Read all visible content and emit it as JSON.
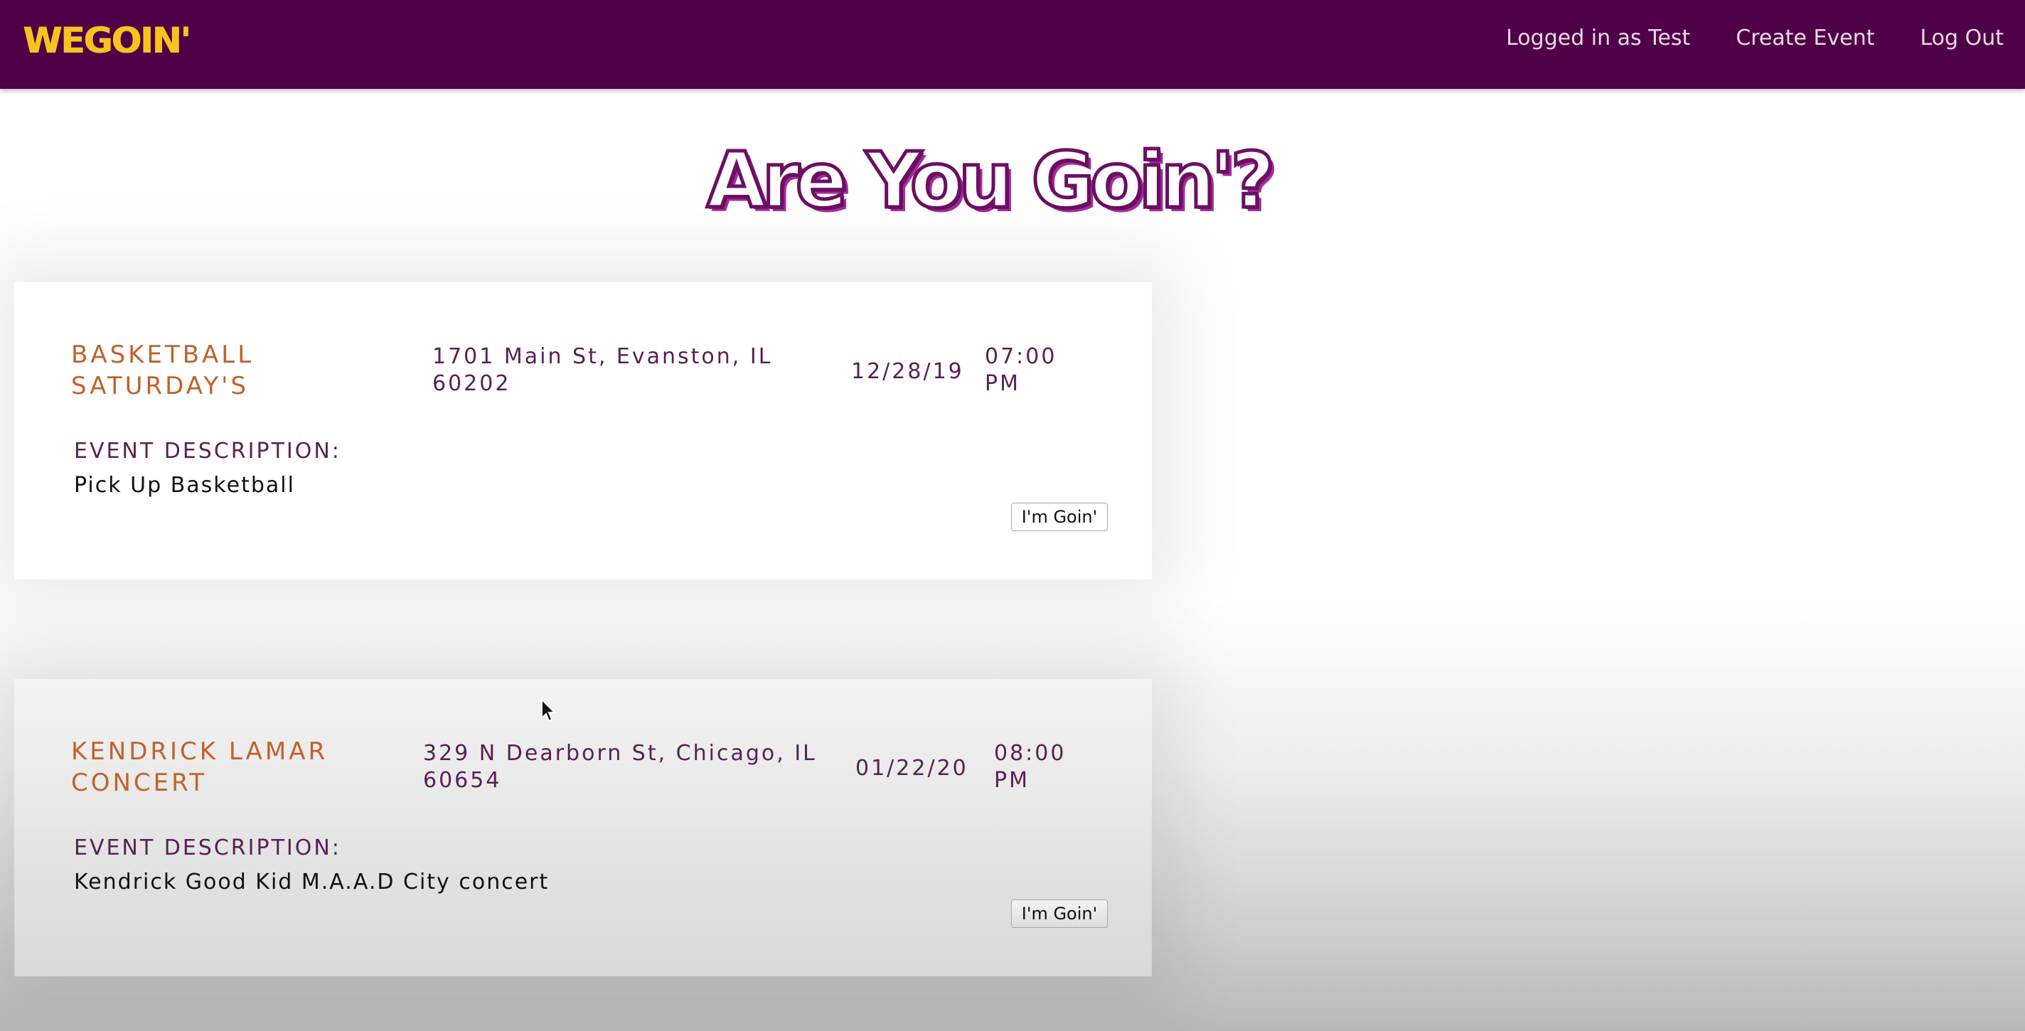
{
  "nav": {
    "brand": "WEGOIN'",
    "logged_in": "Logged in as Test",
    "create_event": "Create Event",
    "log_out": "Log Out"
  },
  "hero": {
    "title": "Are You Goin'?"
  },
  "events": [
    {
      "title": "BASKETBALL SATURDAY'S",
      "address": "1701 Main St, Evanston, IL 60202",
      "date": "12/28/19",
      "time": "07:00 PM",
      "description_label": "EVENT DESCRIPTION:",
      "description": "Pick Up Basketball",
      "button_label": "I'm Goin'"
    },
    {
      "title": "KENDRICK LAMAR CONCERT",
      "address": "329 N Dearborn St, Chicago, IL 60654",
      "date": "01/22/20",
      "time": "08:00 PM",
      "description_label": "EVENT DESCRIPTION:",
      "description": "Kendrick Good Kid M.A.A.D City concert",
      "button_label": "I'm Goin'"
    }
  ],
  "colors": {
    "navbar": "#500047",
    "brand": "#f5c51e",
    "event_title": "#c0622a",
    "event_text": "#5a1e56"
  }
}
